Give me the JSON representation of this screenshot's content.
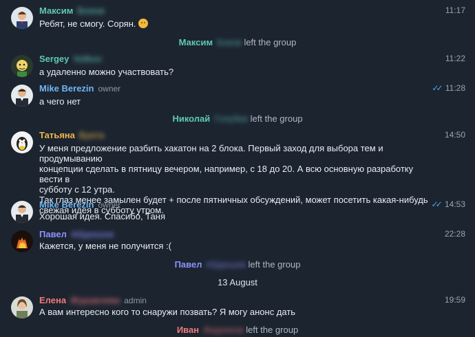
{
  "colors": {
    "background": "#1c2430",
    "name_teal": "#5fc9b7",
    "name_blue": "#6fb6f2",
    "name_orange": "#f0b64d",
    "name_purple": "#8b92ff",
    "name_red": "#f07a7a",
    "check_blue": "#4ea4f6"
  },
  "messages": [
    {
      "name": "Максим",
      "surname": "Боков",
      "role": "",
      "text": "Ребят, не смогу. Сорян. ",
      "emoji": "pensive-face-emoji",
      "time": "11:17",
      "read": false
    },
    {
      "name": "Sergey",
      "surname": "Volkov",
      "role": "",
      "text": "а удаленно можно участвовать?",
      "time": "11:22",
      "read": false
    },
    {
      "name": "Mike Berezin",
      "surname": "",
      "role": "owner",
      "text": "а чего нет",
      "time": "11:28",
      "read": true
    },
    {
      "name": "Татьяна",
      "surname": "Букта",
      "role": "",
      "text": "У меня предложение разбить хакатон на 2 блока. Первый заход для выбора тем и продумыванию\nконцепции сделать в пятницу вечером, например, с 18 до 20. А всю основную разработку вести в\nсубботу с 12 утра.\nТак глаз менее замылен будет + после пятничных обсуждений, может посетить какая-нибудь\nсвежая идея в субботу утром.",
      "time": "14:50",
      "read": false
    },
    {
      "name": "Mike Berezin",
      "surname": "",
      "role": "owner",
      "text": "Хорошая идея. Спасибо,  Таня",
      "time": "14:53",
      "read": true
    },
    {
      "name": "Павел",
      "surname": "Абдюшев",
      "role": "",
      "text": "Кажется, у меня не получится :(",
      "time": "22:28",
      "read": false
    },
    {
      "name": "Елена",
      "surname": "Журавлева",
      "role": "admin",
      "text": "А вам интересно кого то снаружи позвать? Я могу анонс дать",
      "time": "19:59",
      "read": false
    }
  ],
  "service": [
    {
      "name": "Максим",
      "surname": "Боков",
      "text": "left the group"
    },
    {
      "name": "Николай",
      "surname": "Голубев",
      "text": "left the group"
    },
    {
      "name": "Павел",
      "surname": "Абдюшев",
      "text": "left the group"
    },
    {
      "name": "Иван",
      "surname": "Федянков",
      "text": "left the group"
    }
  ],
  "date_separator": "13 August"
}
